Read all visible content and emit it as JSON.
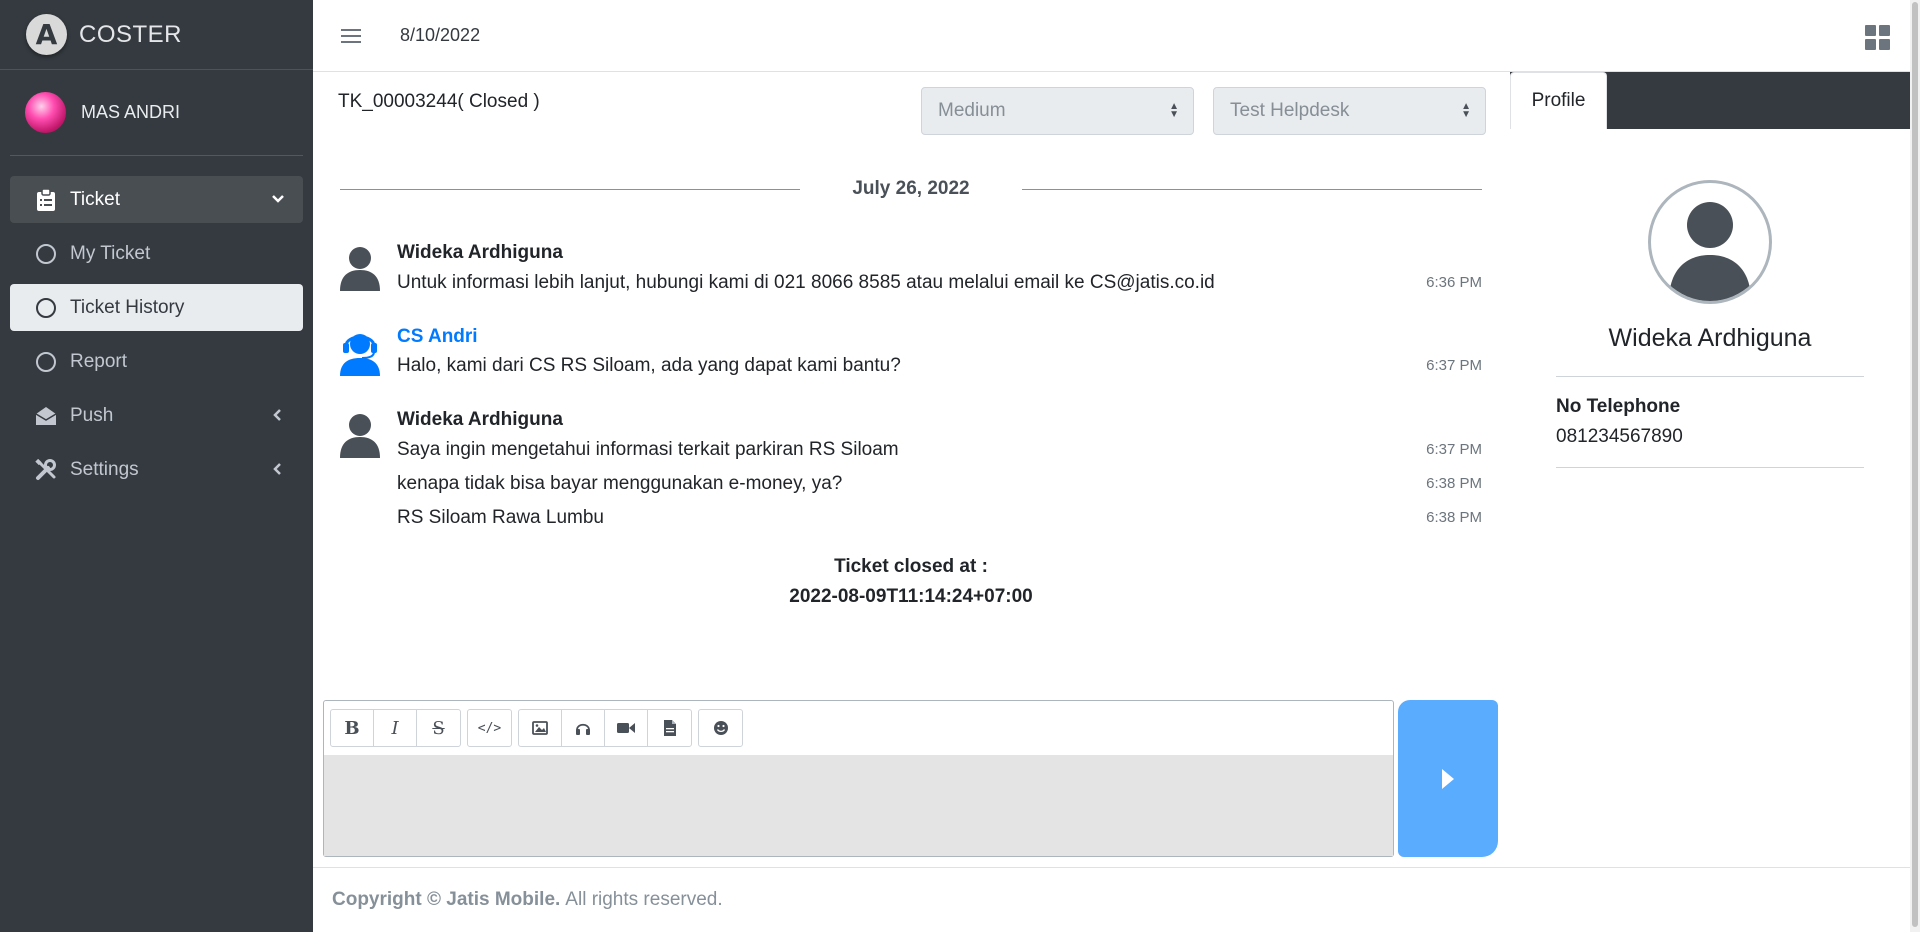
{
  "app": {
    "brand": "COSTER",
    "user_name": "MAS ANDRI"
  },
  "topbar": {
    "date": "8/10/2022"
  },
  "sidebar": {
    "items": [
      {
        "label": "Ticket",
        "icon": "clipboard-icon"
      },
      {
        "label": "My Ticket",
        "icon": "circle-icon"
      },
      {
        "label": "Ticket History",
        "icon": "circle-icon"
      },
      {
        "label": "Report",
        "icon": "circle-icon"
      },
      {
        "label": "Push",
        "icon": "envelope-open-icon"
      },
      {
        "label": "Settings",
        "icon": "tools-icon"
      }
    ]
  },
  "ticket": {
    "title": "TK_00003244( Closed )",
    "priority": "Medium",
    "group": "Test Helpdesk"
  },
  "chat": {
    "date_separator": "July 26, 2022",
    "messages": [
      {
        "sender": "Wideka Ardhiguna",
        "lines": [
          {
            "text": "Untuk informasi lebih lanjut, hubungi kami di 021 8066 8585 atau melalui email ke CS@jatis.co.id",
            "time": "6:36 PM"
          }
        ]
      },
      {
        "sender": "CS Andri",
        "lines": [
          {
            "text": "Halo, kami dari CS RS Siloam, ada yang dapat kami bantu?",
            "time": "6:37 PM"
          }
        ]
      },
      {
        "sender": "Wideka Ardhiguna",
        "lines": [
          {
            "text": "Saya ingin mengetahui informasi terkait parkiran RS Siloam",
            "time": "6:37 PM"
          },
          {
            "text": "kenapa tidak bisa bayar menggunakan e-money, ya?",
            "time": "6:38 PM"
          },
          {
            "text": "RS Siloam Rawa Lumbu",
            "time": "6:38 PM"
          }
        ]
      }
    ],
    "closed_label": "Ticket closed at :",
    "closed_at": "2022-08-09T11:14:24+07:00"
  },
  "composer": {
    "tools": [
      "bold-icon",
      "italic-icon",
      "strikethrough-icon",
      "code-icon",
      "image-icon",
      "audio-icon",
      "video-icon",
      "file-icon",
      "emoji-icon"
    ],
    "send_icon": "play-icon"
  },
  "footer": {
    "brand": "Copyright © Jatis Mobile.",
    "rest": "All rights reserved."
  },
  "profile": {
    "tab": "Profile",
    "name": "Wideka Ardhiguna",
    "tel_label": "No Telephone",
    "tel_value": "081234567890"
  },
  "colors": {
    "sidebar": "#343a40",
    "accent": "#007bff",
    "send": "#5aacff"
  }
}
